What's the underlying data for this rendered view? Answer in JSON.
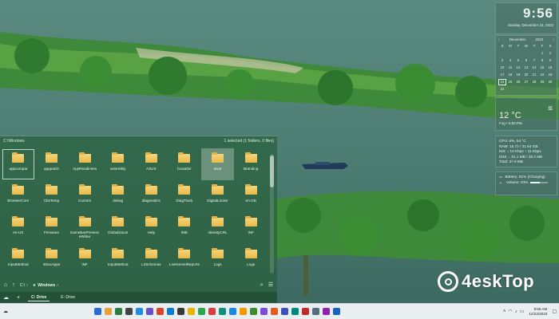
{
  "explorer": {
    "path_title": "C:\\Windows",
    "selection_status": "1 selected (1 folders, 0 files)",
    "folders": [
      "appcompat",
      "apppatch",
      "AppReadiness",
      "assembly",
      "ASUS",
      "bcastdvr",
      "Boot",
      "Branding",
      "BrowserCore",
      "CbsTemp",
      "Cursors",
      "debug",
      "diagnostics",
      "DiagTrack",
      "DigitalLocker",
      "en-GB",
      "en-US",
      "Firmware",
      "GameBarPresenceWriter",
      "GlobalizaUe",
      "Help",
      "IME",
      "IdentityCRL",
      "INF",
      "InputMethod",
      "InboxApps",
      "INF",
      "InputMethod",
      "L2Schemas",
      "LiveKernelReports",
      "Logs",
      "Logs"
    ],
    "selected_index": 0,
    "highlight_index": 6,
    "breadcrumb_drive": "C:\\",
    "breadcrumb_folder": "Windows",
    "drives": [
      "C: Drive",
      "E: Drive"
    ]
  },
  "clock": {
    "time": "9:56",
    "date": "Sunday, December 24, 2023"
  },
  "calendar": {
    "month": "December",
    "year": "2023",
    "weekdays": [
      "S",
      "M",
      "T",
      "W",
      "T",
      "F",
      "S"
    ],
    "days": [
      "",
      "",
      "",
      "",
      "",
      "1",
      "2",
      "3",
      "4",
      "5",
      "6",
      "7",
      "8",
      "9",
      "10",
      "11",
      "12",
      "13",
      "14",
      "15",
      "16",
      "17",
      "18",
      "19",
      "20",
      "21",
      "22",
      "23",
      "24",
      "25",
      "26",
      "27",
      "28",
      "29",
      "30",
      "31"
    ],
    "today": "24"
  },
  "weather": {
    "temp": "12 °C",
    "location": "Fog • 6:50 PM"
  },
  "system": {
    "cpu": "CPU: 6%, 54 °C",
    "ram": "RAM: 15.72 / 31.64 GB",
    "net": "Net: ↓ 14 Kbps ↑ 11 Kbps",
    "disk": "Disk: ↓ 91.1 MB / 28.2 MB",
    "total": "Total: 37.9 MB"
  },
  "battery": {
    "status": "Battery: 81% (Charging)",
    "volume": "Volume: 53%",
    "volume_level": 0.53
  },
  "watermark": {
    "text": "4eskTop"
  },
  "taskbar": {
    "time": "9:56 AM",
    "date": "12/24/2023",
    "app_colors": [
      "#2a6bd1",
      "#e9a13b",
      "#2f7a3d",
      "#444444",
      "#1f8ee0",
      "#6b4fc9",
      "#d9472b",
      "#0b7bd3",
      "#3a3a3a",
      "#e6b400",
      "#2aa84a",
      "#d93f3f",
      "#0f8f7e",
      "#1e88e5",
      "#f29900",
      "#3c8d2f",
      "#7b4ad6",
      "#e55a1f",
      "#3f51b5",
      "#00897b",
      "#c62828",
      "#546e7a",
      "#8e24aa",
      "#1565c0"
    ]
  }
}
